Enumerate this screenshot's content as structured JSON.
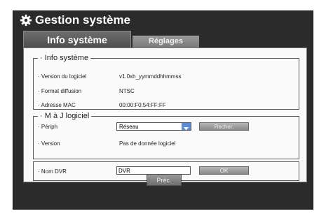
{
  "window": {
    "title": "Gestion système",
    "title_icon": "gear-icon"
  },
  "tabs": [
    {
      "label": "Info système",
      "active": true
    },
    {
      "label": "Réglages",
      "active": false
    }
  ],
  "info": {
    "legend": "· Info système",
    "rows": [
      {
        "label": "· Version du logiciel",
        "value": "v1.0xh_yymmddhhmmss"
      },
      {
        "label": "· Format diffusion",
        "value": "NTSC"
      },
      {
        "label": "· Adresse MAC",
        "value": "00:00:F0:54:FF:FF"
      }
    ]
  },
  "update": {
    "legend": "· M à J logiciel",
    "device_label": "· Périph",
    "device_value": "Réseau",
    "search_button": "Recher.",
    "version_label": "· Version",
    "version_value": "Pas de donnée logiciel"
  },
  "dvr": {
    "label": "· Nom DVR",
    "value": "DVR",
    "ok_button": "OK"
  },
  "footer": {
    "prev_button": "Préc."
  }
}
